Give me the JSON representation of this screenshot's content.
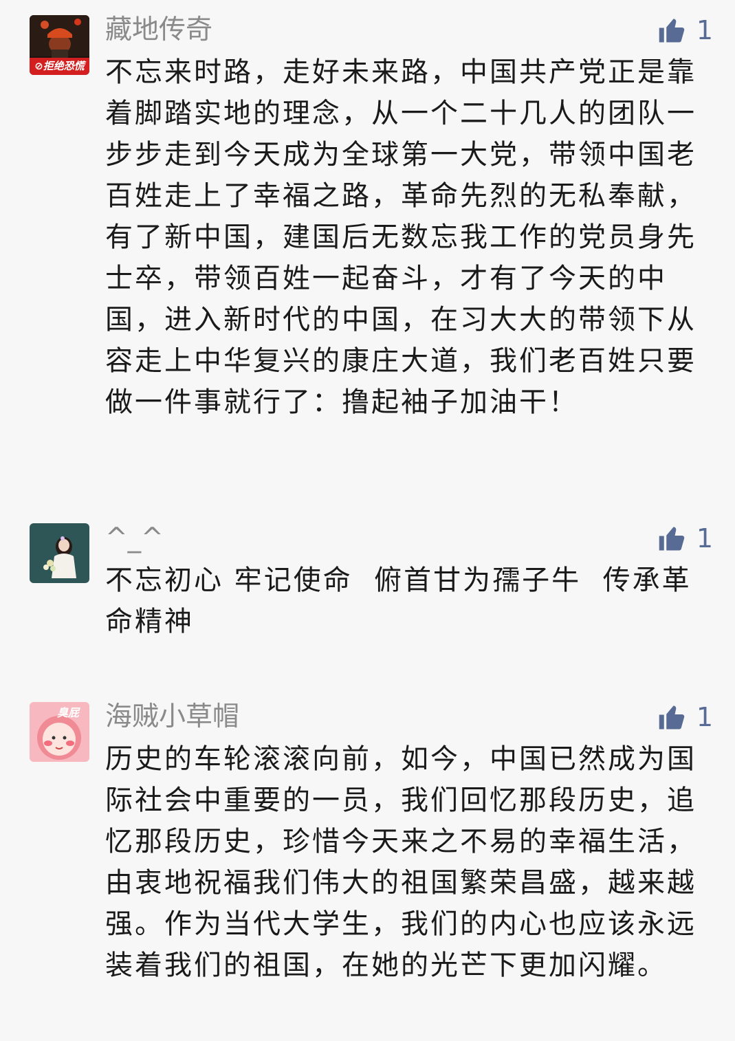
{
  "comments": [
    {
      "nickname": "藏地传奇",
      "avatar_icon": "fireman-avatar-icon",
      "avatar_badge": "⊘拒绝恐慌",
      "likes": "1",
      "content": "不忘来时路，走好未来路，中国共产党正是靠着脚踏实地的理念，从一个二十几人的团队一步步走到今天成为全球第一大党，带领中国老百姓走上了幸福之路，革命先烈的无私奉献，有了新中国，建国后无数忘我工作的党员身先士卒，带领百姓一起奋斗，才有了今天的中国，进入新时代的中国，在习大大的带领下从容走上中华复兴的康庄大道，我们老百姓只要做一件事就行了：撸起袖子加油干！"
    },
    {
      "nickname": "^_^",
      "avatar_icon": "girl-with-flowers-avatar-icon",
      "likes": "1",
      "content": "不忘初心 牢记使命  俯首甘为孺子牛  传承革命精神"
    },
    {
      "nickname": "海贼小草帽",
      "avatar_icon": "pink-cartoon-avatar-icon",
      "avatar_badge": "臭屁",
      "likes": "1",
      "content": "历史的车轮滚滚向前，如今，中国已然成为国际社会中重要的一员，我们回忆那段历史，追忆那段历史，珍惜今天来之不易的幸福生活，由衷地祝福我们伟大的祖国繁荣昌盛，越来越强。作为当代大学生，我们的内心也应该永远装着我们的祖国，在她的光芒下更加闪耀。"
    }
  ],
  "colors": {
    "background": "#f7f7f7",
    "nickname": "#8a8a8a",
    "like": "#576b95",
    "text": "#1a1a1a"
  }
}
